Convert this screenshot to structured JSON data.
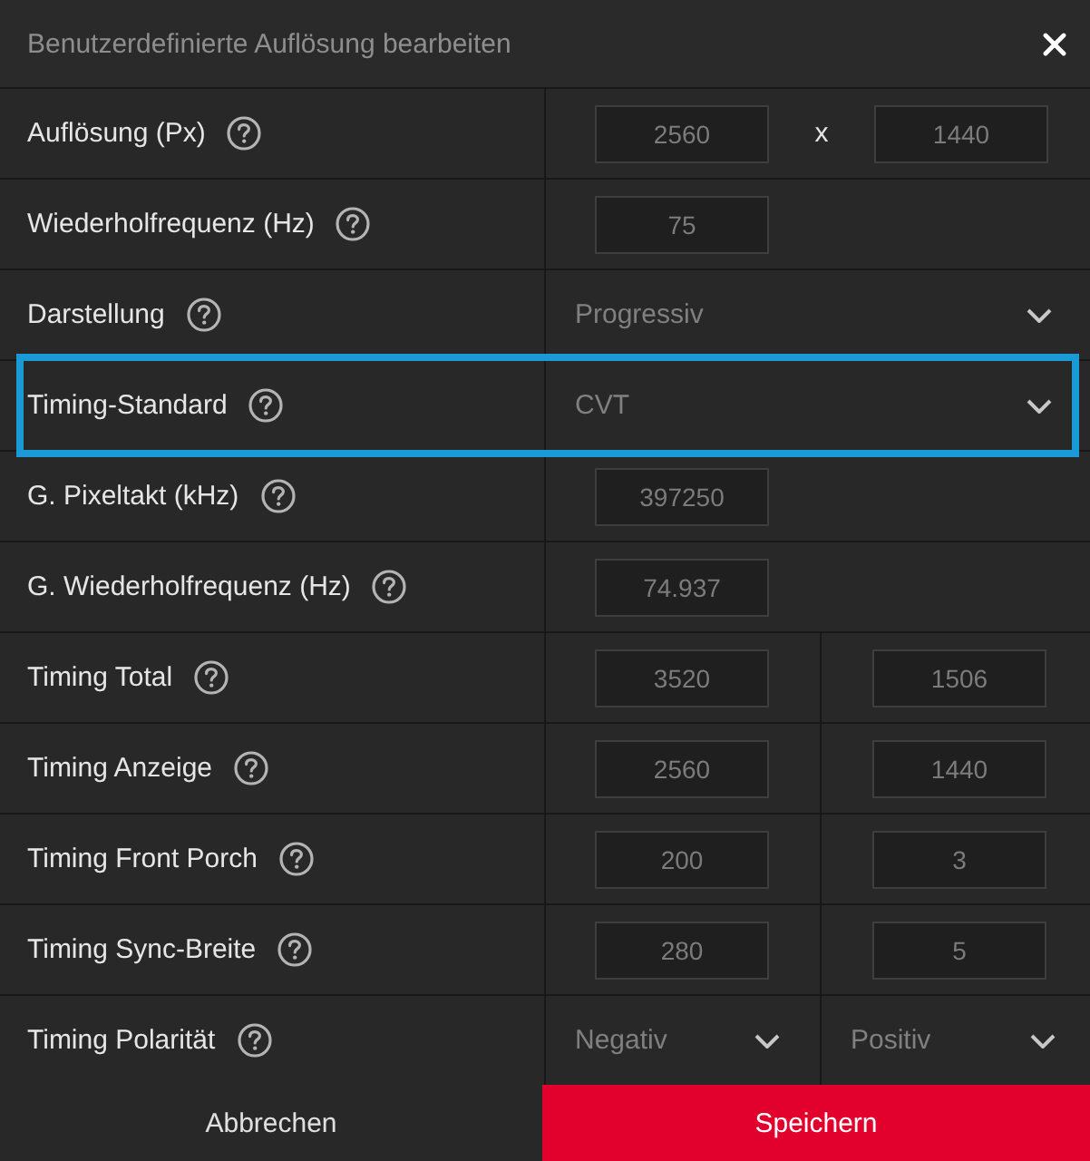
{
  "window": {
    "title": "Benutzerdefinierte Auflösung bearbeiten"
  },
  "rows": [
    {
      "label": "Auflösung (Px)",
      "kind": "pair",
      "highlighted": false,
      "separator": "x",
      "fields": [
        {
          "kind": "input",
          "value": "2560"
        },
        {
          "kind": "input",
          "value": "1440"
        }
      ]
    },
    {
      "label": "Wiederholfrequenz (Hz)",
      "kind": "single",
      "highlighted": false,
      "fields": [
        {
          "kind": "input",
          "value": "75"
        }
      ]
    },
    {
      "label": "Darstellung",
      "kind": "single",
      "highlighted": false,
      "fields": [
        {
          "kind": "select",
          "value": "Progressiv"
        }
      ]
    },
    {
      "label": "Timing-Standard",
      "kind": "single",
      "highlighted": true,
      "fields": [
        {
          "kind": "select",
          "value": "CVT"
        }
      ]
    },
    {
      "label": "G. Pixeltakt (kHz)",
      "kind": "single",
      "highlighted": false,
      "fields": [
        {
          "kind": "input",
          "value": "397250"
        }
      ]
    },
    {
      "label": "G. Wiederholfrequenz (Hz)",
      "kind": "single",
      "highlighted": false,
      "fields": [
        {
          "kind": "input",
          "value": "74.937"
        }
      ]
    },
    {
      "label": "Timing Total",
      "kind": "split",
      "highlighted": false,
      "fields": [
        {
          "kind": "input",
          "value": "3520"
        },
        {
          "kind": "input",
          "value": "1506"
        }
      ]
    },
    {
      "label": "Timing Anzeige",
      "kind": "split",
      "highlighted": false,
      "fields": [
        {
          "kind": "input",
          "value": "2560"
        },
        {
          "kind": "input",
          "value": "1440"
        }
      ]
    },
    {
      "label": "Timing Front Porch",
      "kind": "split",
      "highlighted": false,
      "fields": [
        {
          "kind": "input",
          "value": "200"
        },
        {
          "kind": "input",
          "value": "3"
        }
      ]
    },
    {
      "label": "Timing Sync-Breite",
      "kind": "split",
      "highlighted": false,
      "fields": [
        {
          "kind": "input",
          "value": "280"
        },
        {
          "kind": "input",
          "value": "5"
        }
      ]
    },
    {
      "label": "Timing Polarität",
      "kind": "split",
      "highlighted": false,
      "fields": [
        {
          "kind": "select",
          "value": "Negativ"
        },
        {
          "kind": "select",
          "value": "Positiv"
        }
      ]
    }
  ],
  "buttons": [
    {
      "label": "Abbrechen",
      "kind": "secondary"
    },
    {
      "label": "Speichern",
      "kind": "primary"
    }
  ]
}
